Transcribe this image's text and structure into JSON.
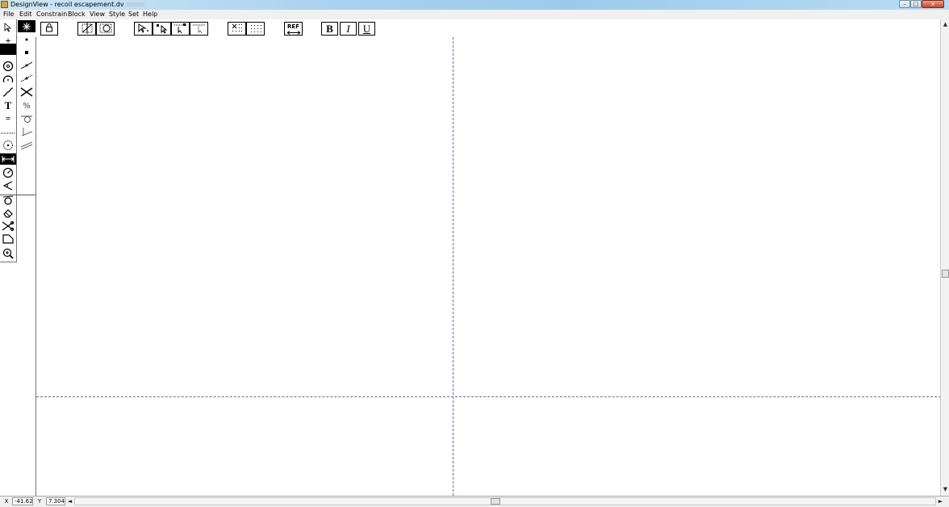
{
  "window": {
    "title": "DesignView - recoil escapement.dv",
    "minimize_symbol": "–",
    "maximize_symbol": "□",
    "close_symbol": "x"
  },
  "menu": [
    "File",
    "Edit",
    "Constrain",
    "Block",
    "View",
    "Style",
    "Set",
    "Help"
  ],
  "toolbar": {
    "bold_label": "B",
    "italic_label": "I",
    "underline_label": "U",
    "ref_label": "REF",
    "icons": [
      "lock-icon",
      "grid-snap-icon",
      "circle-snap-icon",
      "select-point-icon",
      "select-handle-icon",
      "move-node-icon",
      "move-dotted-icon",
      "grid-dense-icon",
      "grid-sparse-icon",
      "reference-icon"
    ]
  },
  "palette_left": {
    "tools": [
      "arrow-select",
      "add-point",
      "filled-rect",
      "circle",
      "arc",
      "curve",
      "text",
      "equal",
      "dotted-line",
      "dotted-circle",
      "dimension",
      "angle",
      "triangle",
      "tangent",
      "eraser",
      "scissors",
      "rect-corner",
      "zoom"
    ],
    "text_tool_label": "T",
    "equal_tool_label": "="
  },
  "palette_right": {
    "tools": [
      "point-star",
      "small-dot",
      "small-square",
      "line-point",
      "line-dots",
      "cross-lines",
      "percent",
      "tangent-circle",
      "angle-lines",
      "parallel-lines"
    ],
    "percent_label": "%"
  },
  "status": {
    "x_label": "X",
    "x_value": "-41.625",
    "y_label": "Y",
    "y_value": "7.304",
    "scroll_left": "◄",
    "scroll_right": "►",
    "scroll_up": "▲",
    "scroll_down": "▼"
  },
  "colors": {
    "guide_line": "#6a6ab0",
    "titlebar": "#a9d2ee",
    "close_button": "#c4452c"
  }
}
